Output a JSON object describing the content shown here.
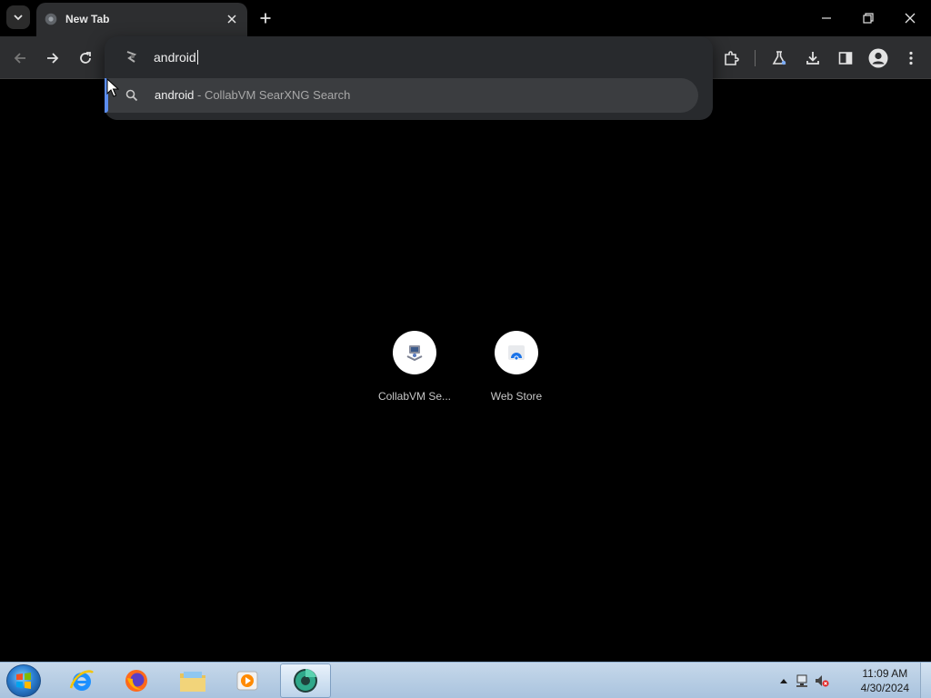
{
  "browser": {
    "tab": {
      "title": "New Tab"
    },
    "omnibox": {
      "input_value": "android",
      "suggestion": {
        "query": "android",
        "separator": " - ",
        "engine": "CollabVM SearXNG Search"
      }
    },
    "shortcuts": [
      {
        "label": "CollabVM Se...",
        "icon": "collabvm-icon"
      },
      {
        "label": "Web Store",
        "icon": "web-store-icon"
      }
    ]
  },
  "taskbar": {
    "apps": [
      "internet-explorer-icon",
      "firefox-icon",
      "file-explorer-icon",
      "media-player-icon",
      "chrome-canary-icon"
    ],
    "clock": {
      "time": "11:09 AM",
      "date": "4/30/2024"
    }
  },
  "colors": {
    "suggestion_accent": "#5b8def",
    "toolbar": "#2d2e30"
  }
}
